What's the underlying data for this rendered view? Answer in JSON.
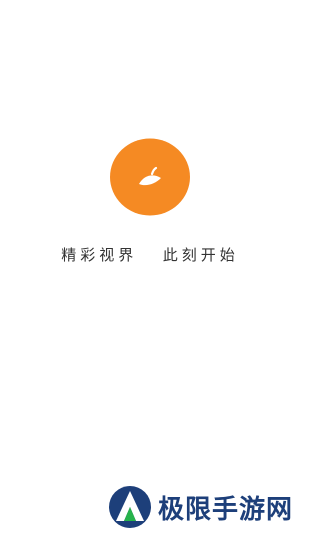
{
  "app": {
    "slogan_part1": "精彩视界",
    "slogan_part2": "此刻开始",
    "logo_icon": "orange-fruit-icon",
    "brand_color": "#f58a23"
  },
  "watermark": {
    "text": "极限手游网",
    "icon": "xtreme-logo-icon",
    "color": "#1d3f7a"
  }
}
